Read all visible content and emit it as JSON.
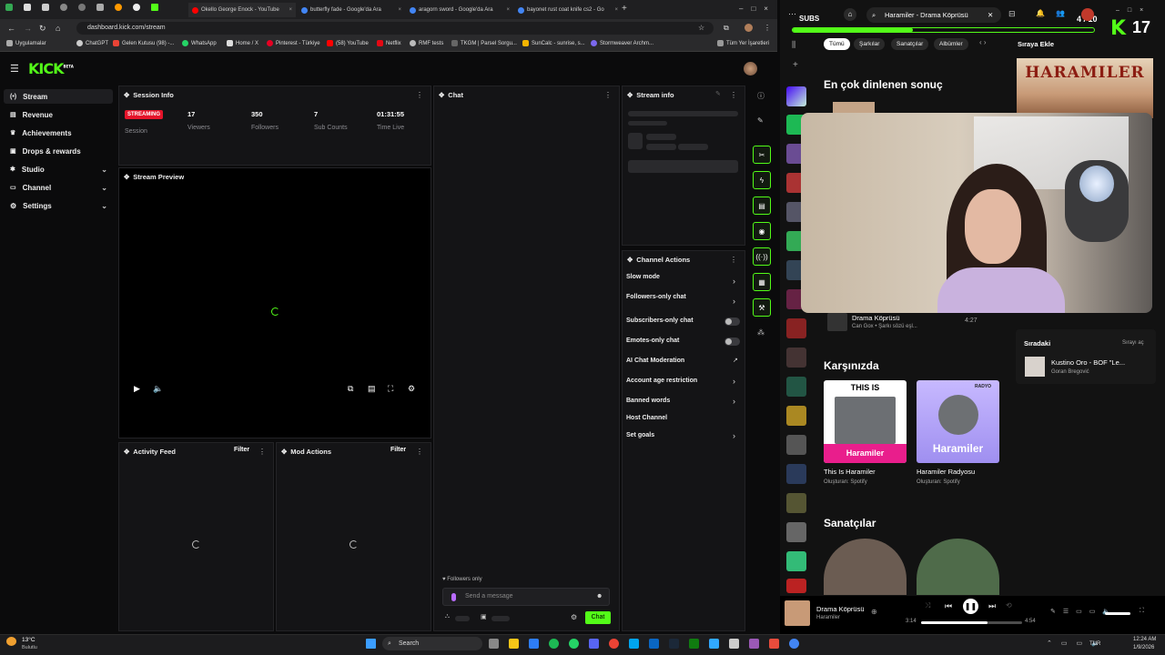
{
  "browser": {
    "tabs": [
      {
        "label": "Okello George Enock - YouTube",
        "color": "#ff0000"
      },
      {
        "label": "butterfly fade - Google'da Ara",
        "color": "#4285f4"
      },
      {
        "label": "aragorn sword - Google'da Ara",
        "color": "#4285f4"
      },
      {
        "label": "bayonet rust coat knife cs2 - Go",
        "color": "#4285f4"
      }
    ],
    "url": "dashboard.kick.com/stream",
    "bookmarks": [
      "Uygulamalar",
      "ChatGPT",
      "Gelen Kutusu (98) -...",
      "WhatsApp",
      "Home / X",
      "Pinterest - Türkiye",
      "(58) YouTube",
      "Netflix",
      "RMF tests",
      "TKGM | Parsel Sorgu...",
      "SunCalc - sunrise, s...",
      "Stormweaver Archm..."
    ],
    "bookmarks_all": "Tüm Yer İşaretleri"
  },
  "kick": {
    "logo": "KICK",
    "logo_badge": "BETA",
    "sidebar": [
      {
        "label": "Stream",
        "icon": "stream-icon",
        "active": true
      },
      {
        "label": "Revenue",
        "icon": "revenue-icon"
      },
      {
        "label": "Achievements",
        "icon": "trophy-icon"
      },
      {
        "label": "Drops & rewards",
        "icon": "gift-icon"
      },
      {
        "label": "Studio",
        "icon": "studio-icon",
        "expandable": true
      },
      {
        "label": "Channel",
        "icon": "channel-icon",
        "expandable": true
      },
      {
        "label": "Settings",
        "icon": "gear-icon",
        "expandable": true
      }
    ],
    "session": {
      "title": "Session Info",
      "status": "STREAMING",
      "session_label": "Session",
      "stats": [
        {
          "value": "17",
          "label": "Viewers"
        },
        {
          "value": "350",
          "label": "Followers"
        },
        {
          "value": "7",
          "label": "Sub Counts"
        },
        {
          "value": "01:31:55",
          "label": "Time Live"
        }
      ]
    },
    "preview_title": "Stream Preview",
    "activity_title": "Activity Feed",
    "activity_filter": "Filter",
    "mod_title": "Mod Actions",
    "mod_filter": "Filter",
    "chat": {
      "title": "Chat",
      "followers_only": "Followers only",
      "placeholder": "Send a message",
      "send": "Chat"
    },
    "stream_info_title": "Stream info",
    "channel_actions": {
      "title": "Channel Actions",
      "items": [
        {
          "label": "Slow mode",
          "kind": "arrow"
        },
        {
          "label": "Followers-only chat",
          "kind": "arrow"
        },
        {
          "label": "Subscribers-only chat",
          "kind": "toggle"
        },
        {
          "label": "Emotes-only chat",
          "kind": "toggle"
        },
        {
          "label": "AI Chat Moderation",
          "kind": "external"
        },
        {
          "label": "Account age restriction",
          "kind": "arrow"
        },
        {
          "label": "Banned words",
          "kind": "arrow"
        },
        {
          "label": "Host Channel",
          "kind": "none"
        },
        {
          "label": "Set goals",
          "kind": "arrow"
        }
      ]
    }
  },
  "spotify": {
    "search": "Haramiler - Drama Köprüsü",
    "subs_label": "SUBS",
    "subs_progress": "4 / 10",
    "subs_fraction": 0.4,
    "kick_count": "17",
    "chips": [
      "Tümü",
      "Şarkılar",
      "Sanatçılar",
      "Albümler"
    ],
    "top_result_heading": "En çok dinlenen sonuç",
    "queue_heading": "Sıraya Ekle",
    "album_art_text": "HARAMILER",
    "track": {
      "title": "Drama Köprüsü",
      "artist": "Can Gox",
      "extra": "• Şarkı sözü eşl...",
      "duration": "4:27"
    },
    "featuring_heading": "Karşınızda",
    "cards": [
      {
        "title": "This Is Haramiler",
        "sub": "Oluşturan: Spotify",
        "art_top": "THIS IS",
        "art_bottom": "Haramiler"
      },
      {
        "title": "Haramiler Radyosu",
        "sub": "Oluşturan: Spotify",
        "art_top": "RADYO",
        "art_bottom": "Haramiler"
      }
    ],
    "artists_heading": "Sanatçılar",
    "next": {
      "heading": "Sıradaki",
      "open_queue": "Sırayı aç",
      "title": "Kustino Oro - BOF \"Le...",
      "artist": "Goran Bregović"
    },
    "player": {
      "title": "Drama Köprüsü",
      "artist": "Haramiler",
      "elapsed": "3:14",
      "total": "4:54",
      "progress": 0.66
    }
  },
  "taskbar": {
    "weather_temp": "13°C",
    "weather_desc": "Bulutlu",
    "search": "Search",
    "lang": "TUR",
    "time": "12:24 AM",
    "date": "1/9/2026"
  },
  "colors": {
    "kick_green": "#53fc18",
    "live_red": "#e5142a",
    "spotify_bg": "#121212"
  }
}
